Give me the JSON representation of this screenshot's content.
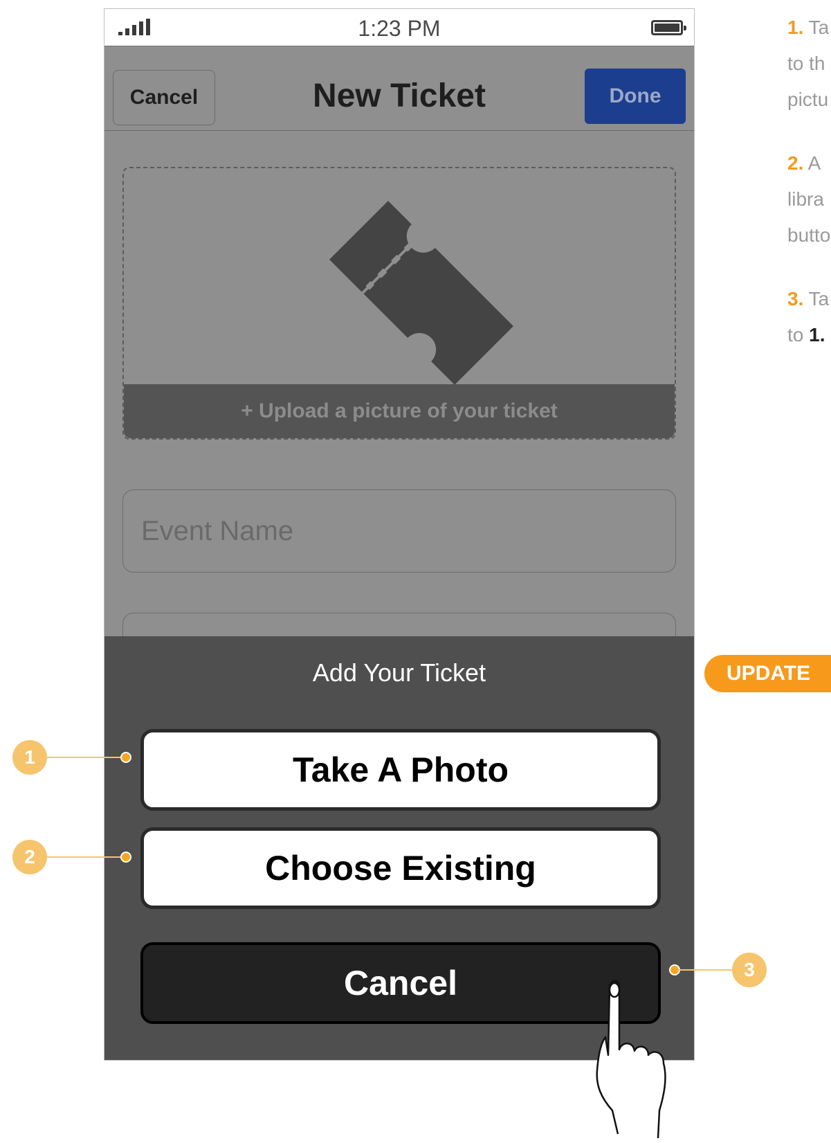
{
  "status_bar": {
    "time": "1:23 PM"
  },
  "nav": {
    "cancel_label": "Cancel",
    "title": "New Ticket",
    "done_label": "Done"
  },
  "upload": {
    "label": "+ Upload a picture of your ticket"
  },
  "form": {
    "event_name_placeholder": "Event Name"
  },
  "action_sheet": {
    "title": "Add Your Ticket",
    "take_photo_label": "Take A Photo",
    "choose_existing_label": "Choose Existing",
    "cancel_label": "Cancel"
  },
  "annotations": {
    "callout_1": "1",
    "callout_2": "2",
    "callout_3": "3",
    "update_badge": "UPDATE",
    "notes": [
      {
        "num": "1.",
        "lines": [
          "Ta",
          "to th",
          "pictu"
        ]
      },
      {
        "num": "2.",
        "lines": [
          "A",
          "libra",
          "butto"
        ]
      },
      {
        "num": "3.",
        "lines": [
          "Ta",
          "to",
          "1."
        ]
      }
    ]
  },
  "colors": {
    "done_button": "#1c3e8f",
    "sheet_background": "#4f4f4f",
    "accent_orange": "#f39a1e",
    "callout": "#f6c46c"
  },
  "icons": [
    "signal-icon",
    "battery-icon",
    "ticket-icon",
    "hand-pointer-icon"
  ]
}
